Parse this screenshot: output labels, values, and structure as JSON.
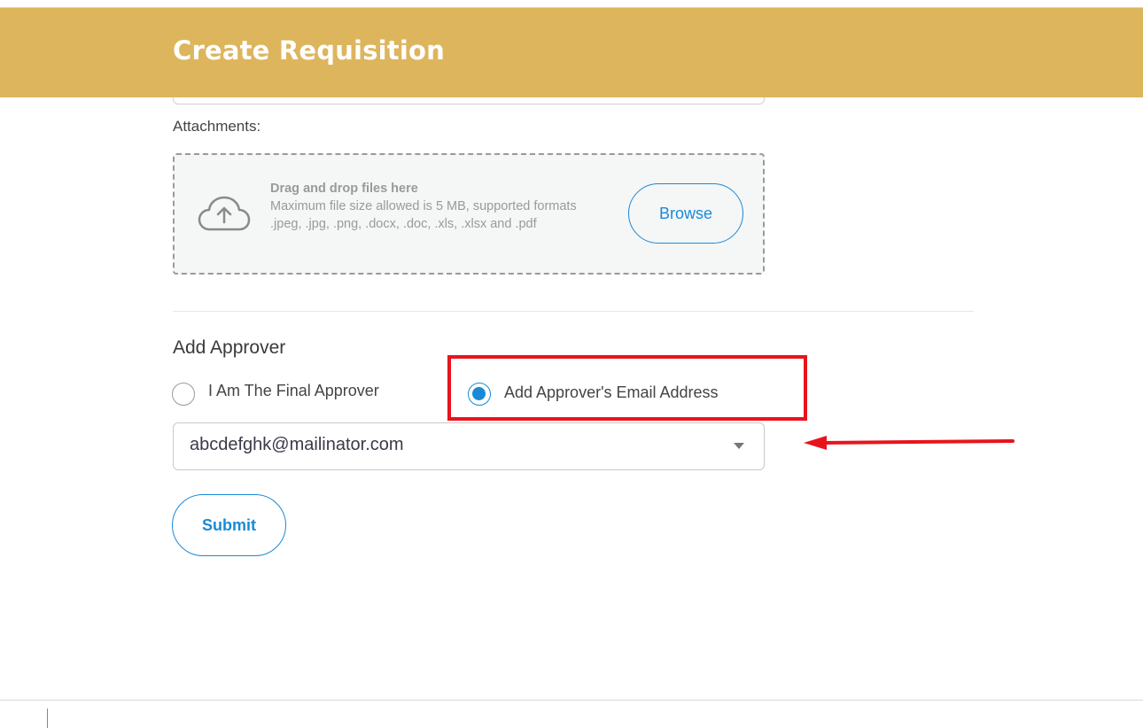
{
  "header": {
    "title": "Create Requisition",
    "bg_color": "#DDB55C"
  },
  "attachments": {
    "label": "Attachments:",
    "dropzone_title": "Drag and drop files here",
    "dropzone_desc": "Maximum file size allowed is 5 MB, supported formats .jpeg, .jpg, .png, .docx, .doc, .xls, .xlsx and .pdf",
    "browse_label": "Browse",
    "icon": "cloud-upload-icon"
  },
  "approver": {
    "title": "Add Approver",
    "options": [
      {
        "label": "I Am The Final Approver",
        "selected": false
      },
      {
        "label": "Add Approver's Email Address",
        "selected": true
      }
    ],
    "email_value": "abcdefghk@mailinator.com"
  },
  "submit_label": "Submit",
  "colors": {
    "accent": "#1A8AD6",
    "annotation": "#E8141C"
  }
}
